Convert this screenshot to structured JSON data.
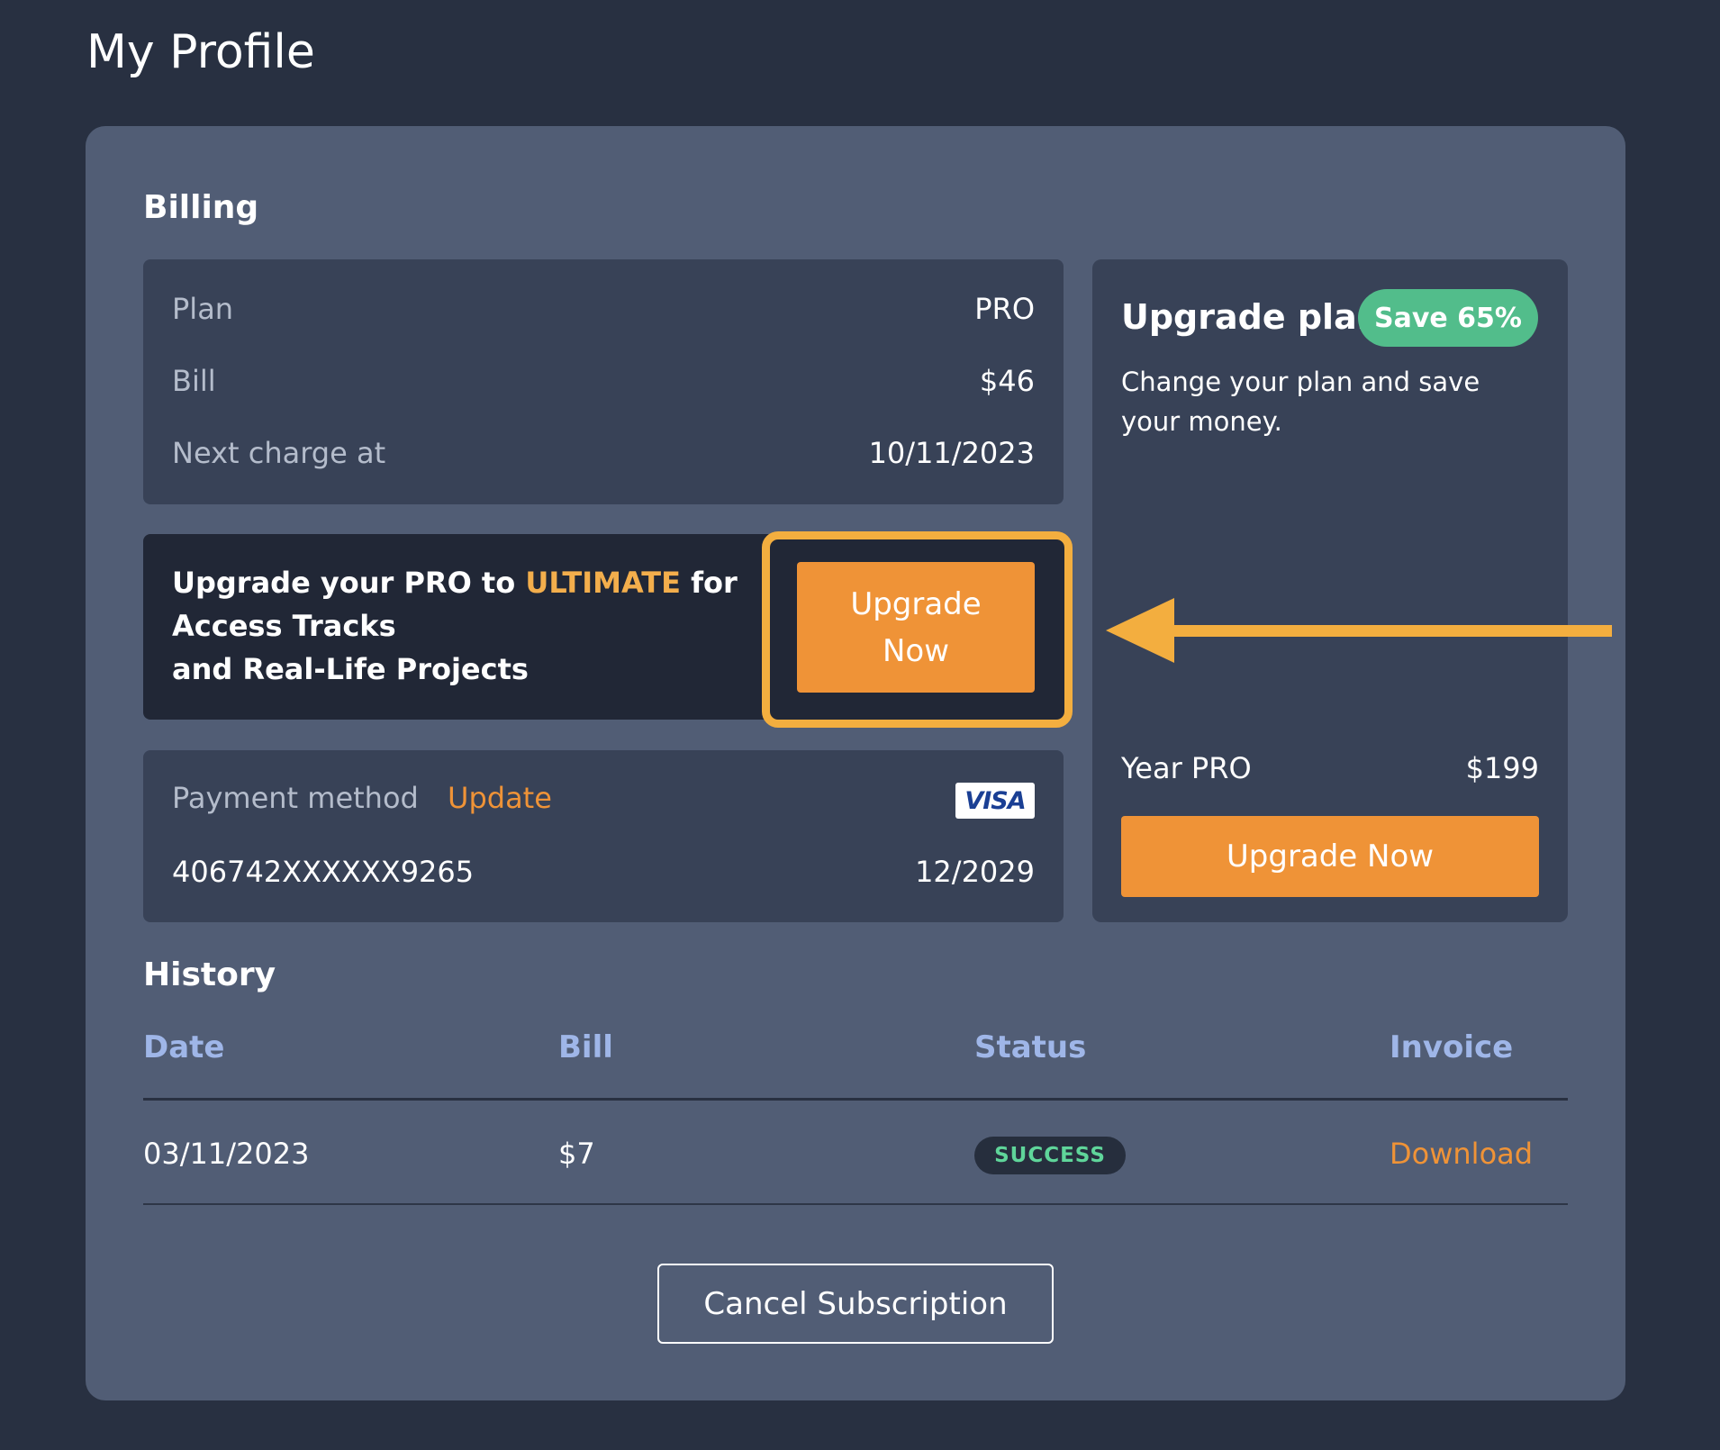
{
  "page": {
    "title": "My Profile"
  },
  "billing": {
    "title": "Billing",
    "plan_label": "Plan",
    "plan_value": "PRO",
    "bill_label": "Bill",
    "bill_value": "$46",
    "next_charge_label": "Next charge at",
    "next_charge_value": "10/11/2023"
  },
  "promo": {
    "text_before": "Upgrade your PRO to ",
    "highlight": "ULTIMATE",
    "text_after": " for",
    "line2": "Access Tracks",
    "line3": "and Real-Life Projects",
    "button_line1": "Upgrade",
    "button_line2": "Now"
  },
  "payment": {
    "label": "Payment method",
    "update_link": "Update",
    "card_brand": "VISA",
    "card_number": "406742XXXXXX9265",
    "expiry": "12/2029"
  },
  "upgrade_plan": {
    "title": "Upgrade plan",
    "badge": "Save 65%",
    "description": "Change your plan and save your money.",
    "option_name": "Year PRO",
    "option_price": "$199",
    "button_label": "Upgrade Now"
  },
  "history": {
    "title": "History",
    "columns": [
      "Date",
      "Bill",
      "Status",
      "Invoice"
    ],
    "rows": [
      {
        "date": "03/11/2023",
        "bill": "$7",
        "status": "SUCCESS",
        "invoice": "Download"
      }
    ]
  },
  "cancel_label": "Cancel Subscription",
  "colors": {
    "background": "#283041",
    "card": "#515d75",
    "panel": "#384257",
    "accent_orange": "#ef9337",
    "highlight_yellow": "#f3ae3f",
    "success_green": "#52bd8b"
  }
}
